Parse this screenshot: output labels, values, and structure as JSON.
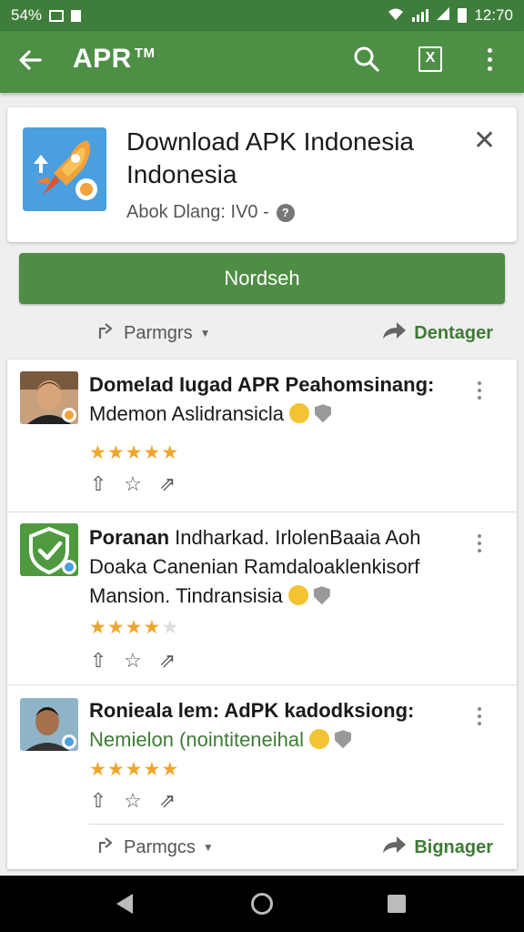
{
  "status_bar": {
    "left_text": "54%",
    "time": "12:70"
  },
  "app_bar": {
    "title": "APR",
    "title_mark": "TM",
    "box_icon_text": "X"
  },
  "featured": {
    "title": "Download APK Indonesia Indonesia",
    "subtitle": "Abok Dlang: IV0 -",
    "help_text": "?",
    "close_text": "✕"
  },
  "install_button": {
    "label": "Nordseh"
  },
  "top_actions": {
    "left_label": "Parmgrs",
    "right_label": "Dentager"
  },
  "items": [
    {
      "title": "Domelad Iugad APR Peahomsinang:",
      "subtitle": "Mdemon Aslidransicla",
      "rating": 5,
      "rating_max": 5
    },
    {
      "title": "Poranan",
      "title_rest": "Indharkad. IrlolenBaaia Aoh Doaka Canenian Ramdaloaklenkisorf Mansion. Tindransisia",
      "rating": 4,
      "rating_max": 5
    },
    {
      "title": "Ronieala lem: AdPK kadodksiong:",
      "subtitle": "Nemielon (nointiteneihal",
      "subtitle_color": "#3f7a36",
      "rating": 5,
      "rating_max": 5
    }
  ],
  "bottom_actions": {
    "left_label": "Parmgcs",
    "right_label": "Bignager"
  },
  "colors": {
    "primary": "#4e8f46",
    "status": "#3f7d3a",
    "accent_text": "#3f7a36",
    "star": "#f0a52c"
  }
}
